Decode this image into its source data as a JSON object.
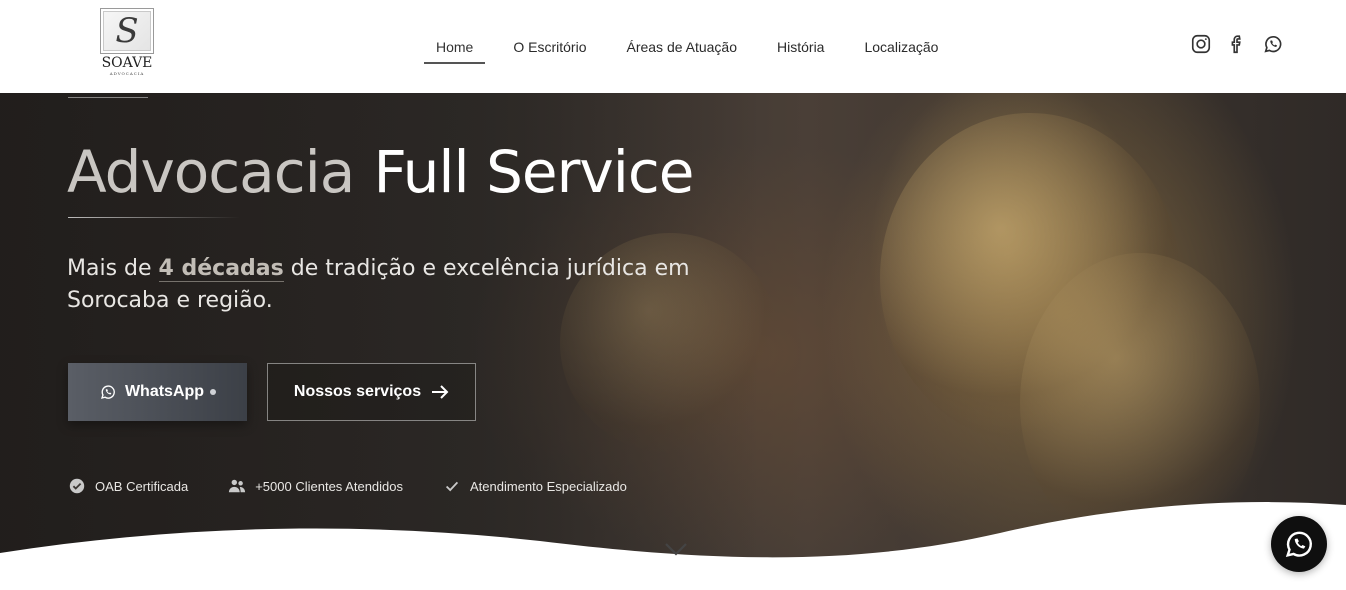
{
  "brand": {
    "logo_letter": "S",
    "logo_word": "SOAVE",
    "logo_sub": "ADVOCACIA"
  },
  "nav": {
    "items": [
      {
        "label": "Home",
        "active": true
      },
      {
        "label": "O Escritório",
        "active": false
      },
      {
        "label": "Áreas de Atuação",
        "active": false
      },
      {
        "label": "História",
        "active": false
      },
      {
        "label": "Localização",
        "active": false
      }
    ]
  },
  "social": {
    "icons": [
      "instagram-icon",
      "facebook-icon",
      "whatsapp-icon"
    ]
  },
  "hero": {
    "title_light": "Advocacia",
    "title_bold": "Full Service",
    "subtitle_pre": "Mais de ",
    "subtitle_highlight": "4 décadas",
    "subtitle_post": " de tradição e excelência jurídica em Sorocaba e região.",
    "whatsapp_button": "WhatsApp",
    "services_button": "Nossos serviços",
    "badges": [
      {
        "icon": "check-circle-icon",
        "label": "OAB Certificada"
      },
      {
        "icon": "users-icon",
        "label": "+5000 Clientes Atendidos"
      },
      {
        "icon": "check-icon",
        "label": "Atendimento Especializado"
      }
    ]
  },
  "colors": {
    "header_bg": "#ffffff",
    "hero_dark": "#2f2a27",
    "accent_gray": "#4a4e55",
    "fab_bg": "#0f0f0f"
  }
}
